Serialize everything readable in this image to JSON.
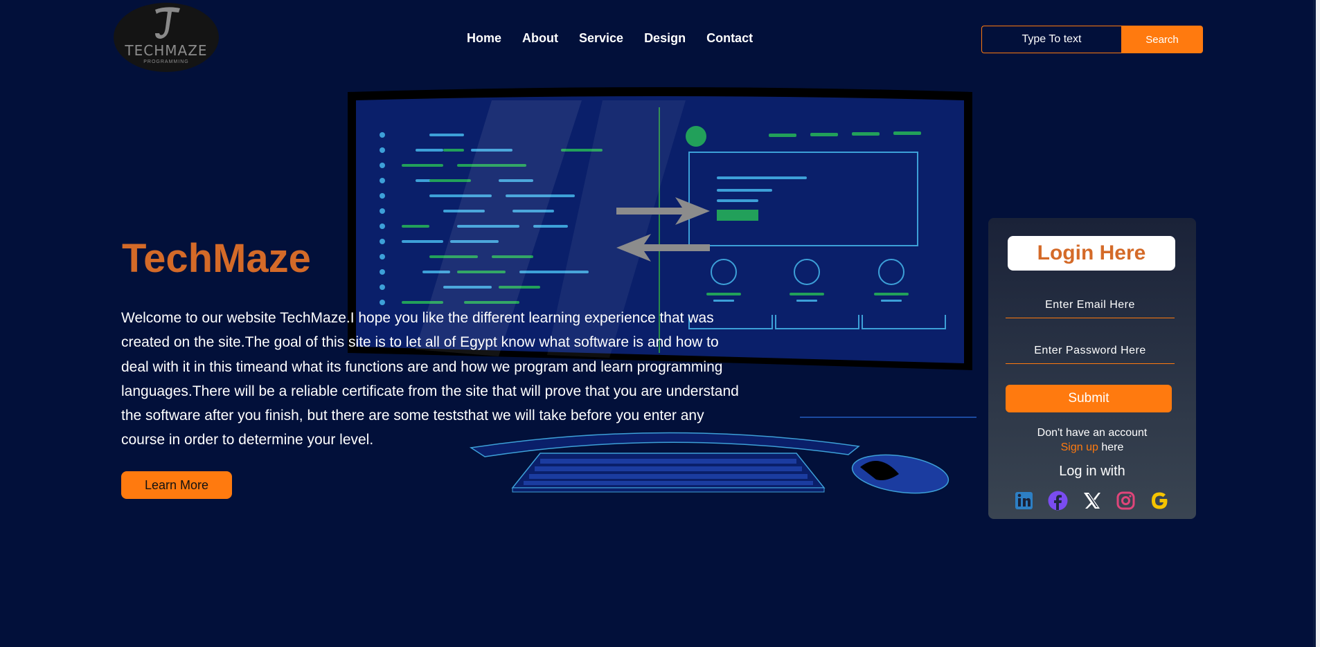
{
  "logo": {
    "letter": "T",
    "word": "TECHMAZE",
    "sub": "PROGRAMMING"
  },
  "nav": [
    {
      "label": "Home"
    },
    {
      "label": "About"
    },
    {
      "label": "Service"
    },
    {
      "label": "Design"
    },
    {
      "label": "Contact"
    }
  ],
  "search": {
    "placeholder": "Type To text",
    "button_label": "Search"
  },
  "hero": {
    "title": "TechMaze",
    "text": "Welcome to our website TechMaze.I hope you like the different learning experience that was created on the site.The goal of this site is to let all of Egypt know what software is and how to deal with it in this timeand what its functions are and how we program and learn programming languages.There will be a reliable certificate from the site that will prove that you are understand the software after you finish, but there are some teststhat we will take before you enter any course in order to determine your level.",
    "button_label": "Learn More"
  },
  "login": {
    "title": "Login Here",
    "email_placeholder": "Enter Email Here",
    "password_placeholder": "Enter Password Here",
    "submit_label": "Submit",
    "no_account": "Don't have an account",
    "signup_link": "Sign up",
    "signup_suffix": " here",
    "login_with": "Log in with",
    "socials": [
      "linkedin-icon",
      "facebook-icon",
      "x-icon",
      "instagram-icon",
      "google-icon"
    ]
  },
  "colors": {
    "background": "#02103a",
    "accent": "#ff7a0f",
    "title": "#d46a28"
  }
}
